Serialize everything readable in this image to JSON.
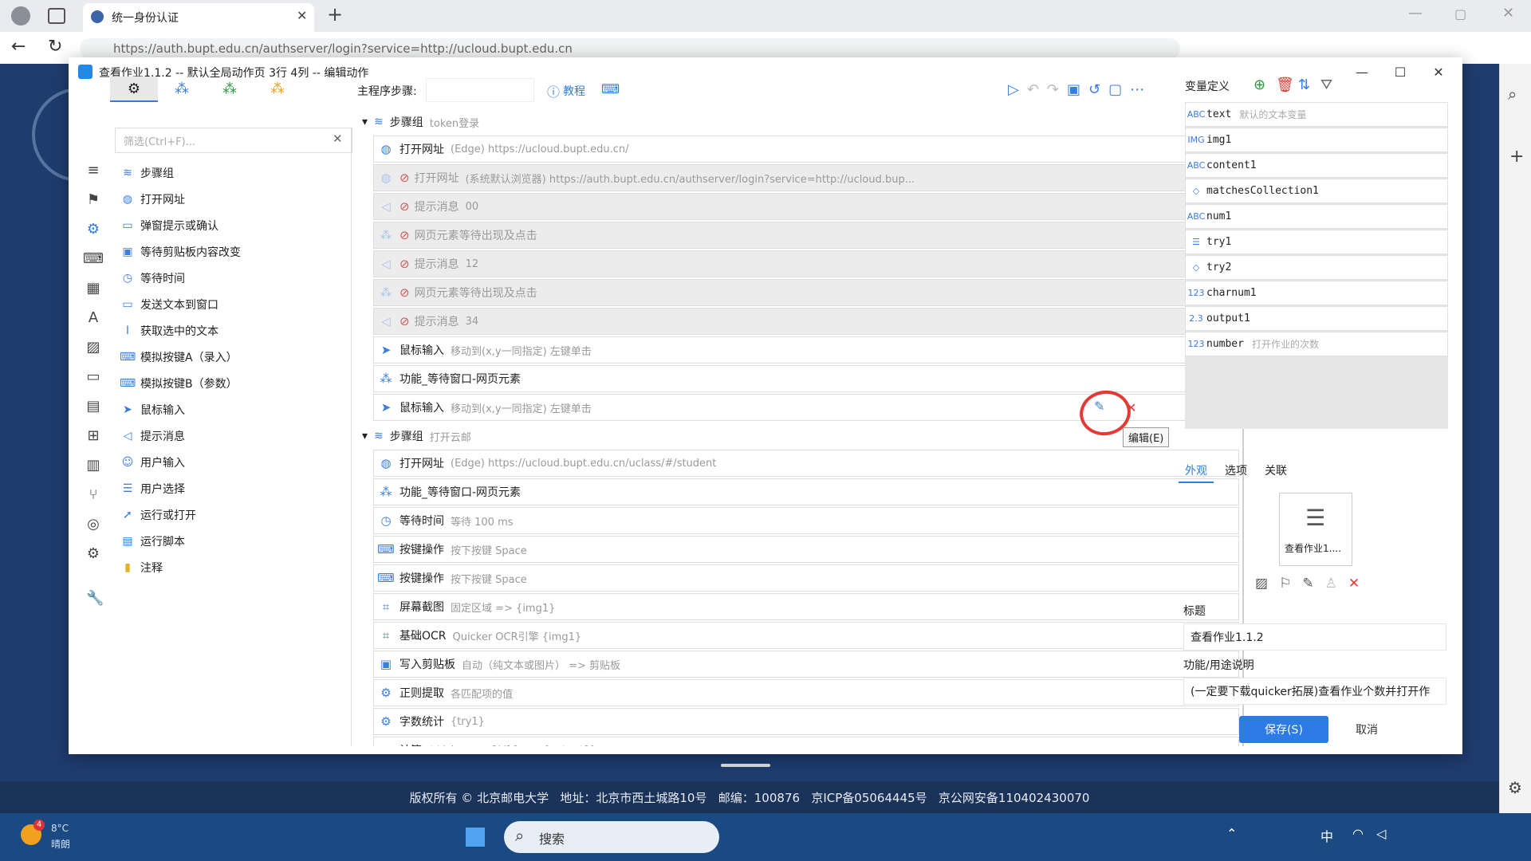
{
  "browser": {
    "tab_title": "统一身份认证",
    "url": "https://auth.bupt.edu.cn/authserver/login?service=http://ucloud.bupt.edu.cn"
  },
  "page": {
    "footer": "版权所有 © 北京邮电大学   地址：北京市西土城路10号   邮编：100876   京ICP备05064445号   京公网安备110402430070"
  },
  "taskbar": {
    "search_placeholder": "搜索",
    "weather_badge": "4",
    "weather_temp": "8°C",
    "weather_desc": "晴朗",
    "tray_lang": "中"
  },
  "dialog": {
    "title": "查看作业1.1.2 -- 默认全局动作页 3行 4列 -- 编辑动作",
    "search_placeholder": "筛选(Ctrl+F)...",
    "main_steps_label": "主程序步骤:",
    "tutorial_label": "教程",
    "library": [
      {
        "icon": "layers-icon",
        "label": "步骤组"
      },
      {
        "icon": "globe-icon",
        "label": "打开网址"
      },
      {
        "icon": "dialog-icon",
        "label": "弹窗提示或确认"
      },
      {
        "icon": "clipboard-icon",
        "label": "等待剪贴板内容改变"
      },
      {
        "icon": "clock-icon",
        "label": "等待时间"
      },
      {
        "icon": "window-icon",
        "label": "发送文本到窗口"
      },
      {
        "icon": "cursor-text-icon",
        "label": "获取选中的文本"
      },
      {
        "icon": "keyboard-icon",
        "label": "模拟按键A（录入）"
      },
      {
        "icon": "keyboard-icon",
        "label": "模拟按键B（参数）"
      },
      {
        "icon": "pointer-icon",
        "label": "鼠标输入"
      },
      {
        "icon": "megaphone-icon",
        "label": "提示消息"
      },
      {
        "icon": "user-icon",
        "label": "用户输入"
      },
      {
        "icon": "list-icon",
        "label": "用户选择"
      },
      {
        "icon": "send-icon",
        "label": "运行或打开"
      },
      {
        "icon": "script-icon",
        "label": "运行脚本"
      },
      {
        "icon": "note-icon",
        "label": "注释"
      }
    ],
    "groups": [
      {
        "name": "步骤组",
        "desc": "token登录",
        "rows": [
          {
            "icon": "globe-icon",
            "title": "打开网址",
            "desc": "(Edge) https://ucloud.bupt.edu.cn/",
            "num": "50",
            "disabled": false
          },
          {
            "icon": "globe-icon",
            "title": "打开网址",
            "desc": "(系统默认浏览器) https://auth.bupt.edu.cn/authserver/login?service=http://ucloud.bup...",
            "num": "",
            "disabled": true
          },
          {
            "icon": "megaphone-icon",
            "title": "提示消息",
            "desc": "00",
            "num": "",
            "disabled": true
          },
          {
            "icon": "cubes-icon",
            "title": "网页元素等待出现及点击",
            "desc": "",
            "num": "50",
            "disabled": true
          },
          {
            "icon": "megaphone-icon",
            "title": "提示消息",
            "desc": "12",
            "num": "",
            "disabled": true
          },
          {
            "icon": "cubes-icon",
            "title": "网页元素等待出现及点击",
            "desc": "",
            "num": "",
            "disabled": true
          },
          {
            "icon": "megaphone-icon",
            "title": "提示消息",
            "desc": "34",
            "num": "",
            "disabled": true
          },
          {
            "icon": "pointer-icon",
            "title": "鼠标输入",
            "desc": "移动到(x,y一同指定)   左键单击",
            "num": "50",
            "disabled": false
          },
          {
            "icon": "cubes-icon",
            "title": "功能_等待窗口-网页元素",
            "desc": "",
            "num": "",
            "disabled": false
          },
          {
            "icon": "pointer-icon",
            "title": "鼠标输入",
            "desc": "移动到(x,y一同指定)   左键单击",
            "num": "10",
            "disabled": false
          }
        ]
      },
      {
        "name": "步骤组",
        "desc": "打开云邮",
        "rows": [
          {
            "icon": "globe-icon",
            "title": "打开网址",
            "desc": "(Edge) https://ucloud.bupt.edu.cn/uclass/#/student",
            "num": "",
            "disabled": false
          },
          {
            "icon": "cubes-icon",
            "title": "功能_等待窗口-网页元素",
            "desc": "",
            "num": "",
            "disabled": false
          },
          {
            "icon": "clock-icon",
            "title": "等待时间",
            "desc": "等待 100 ms",
            "num": "",
            "disabled": false
          },
          {
            "icon": "keyboard-icon",
            "title": "按键操作",
            "desc": "按下按键 Space",
            "num": "",
            "disabled": false
          },
          {
            "icon": "keyboard-icon",
            "title": "按键操作",
            "desc": "按下按键 Space",
            "num": "",
            "disabled": false
          },
          {
            "icon": "crop-icon",
            "title": "屏幕截图",
            "desc": "固定区域 => {img1}",
            "num": "",
            "disabled": false
          },
          {
            "icon": "crop-icon",
            "title": "基础OCR",
            "desc": "Quicker OCR引擎 {img1}",
            "num": "",
            "disabled": false
          },
          {
            "icon": "clipboard-icon",
            "title": "写入剪贴板",
            "desc": "自动（纯文本或图片） => 剪贴板",
            "num": "",
            "disabled": false
          },
          {
            "icon": "gear-icon",
            "title": "正则提取",
            "desc": "各匹配项的值",
            "num": "",
            "disabled": false
          },
          {
            "icon": "gear-icon",
            "title": "字数统计",
            "desc": "{try1}",
            "num": "",
            "disabled": false
          },
          {
            "icon": "calc-icon",
            "title": "计算",
            "desc": "$$(charnum1)/10 => {output1}",
            "num": "",
            "disabled": false
          }
        ]
      }
    ],
    "edit_tooltip": "编辑(E)",
    "variables_title": "变量定义",
    "variables": [
      {
        "type": "ABC",
        "name": "text",
        "desc": "默认的文本变量"
      },
      {
        "type": "IMG",
        "name": "img1",
        "desc": ""
      },
      {
        "type": "ABC",
        "name": "content1",
        "desc": ""
      },
      {
        "type": "◇",
        "name": "matchesCollection1",
        "desc": ""
      },
      {
        "type": "ABC",
        "name": "num1",
        "desc": ""
      },
      {
        "type": "☰",
        "name": "try1",
        "desc": ""
      },
      {
        "type": "◇",
        "name": "try2",
        "desc": ""
      },
      {
        "type": "123",
        "name": "charnum1",
        "desc": ""
      },
      {
        "type": "2.3",
        "name": "output1",
        "desc": ""
      },
      {
        "type": "123",
        "name": "number",
        "desc": "打开作业的次数"
      }
    ],
    "prop_tabs": [
      "外观",
      "选项",
      "关联"
    ],
    "action_icon_label": "查看作业1....",
    "title_label": "标题",
    "title_value": "查看作业1.1.2",
    "purpose_label": "功能/用途说明",
    "purpose_value": "(一定要下载quicker拓展)查看作业个数并打开作",
    "save_label": "保存(S)",
    "cancel_label": "取消"
  },
  "colors": {
    "accent": "#2d7be5",
    "annotation": "#e53935",
    "disabled": "#ececec"
  }
}
